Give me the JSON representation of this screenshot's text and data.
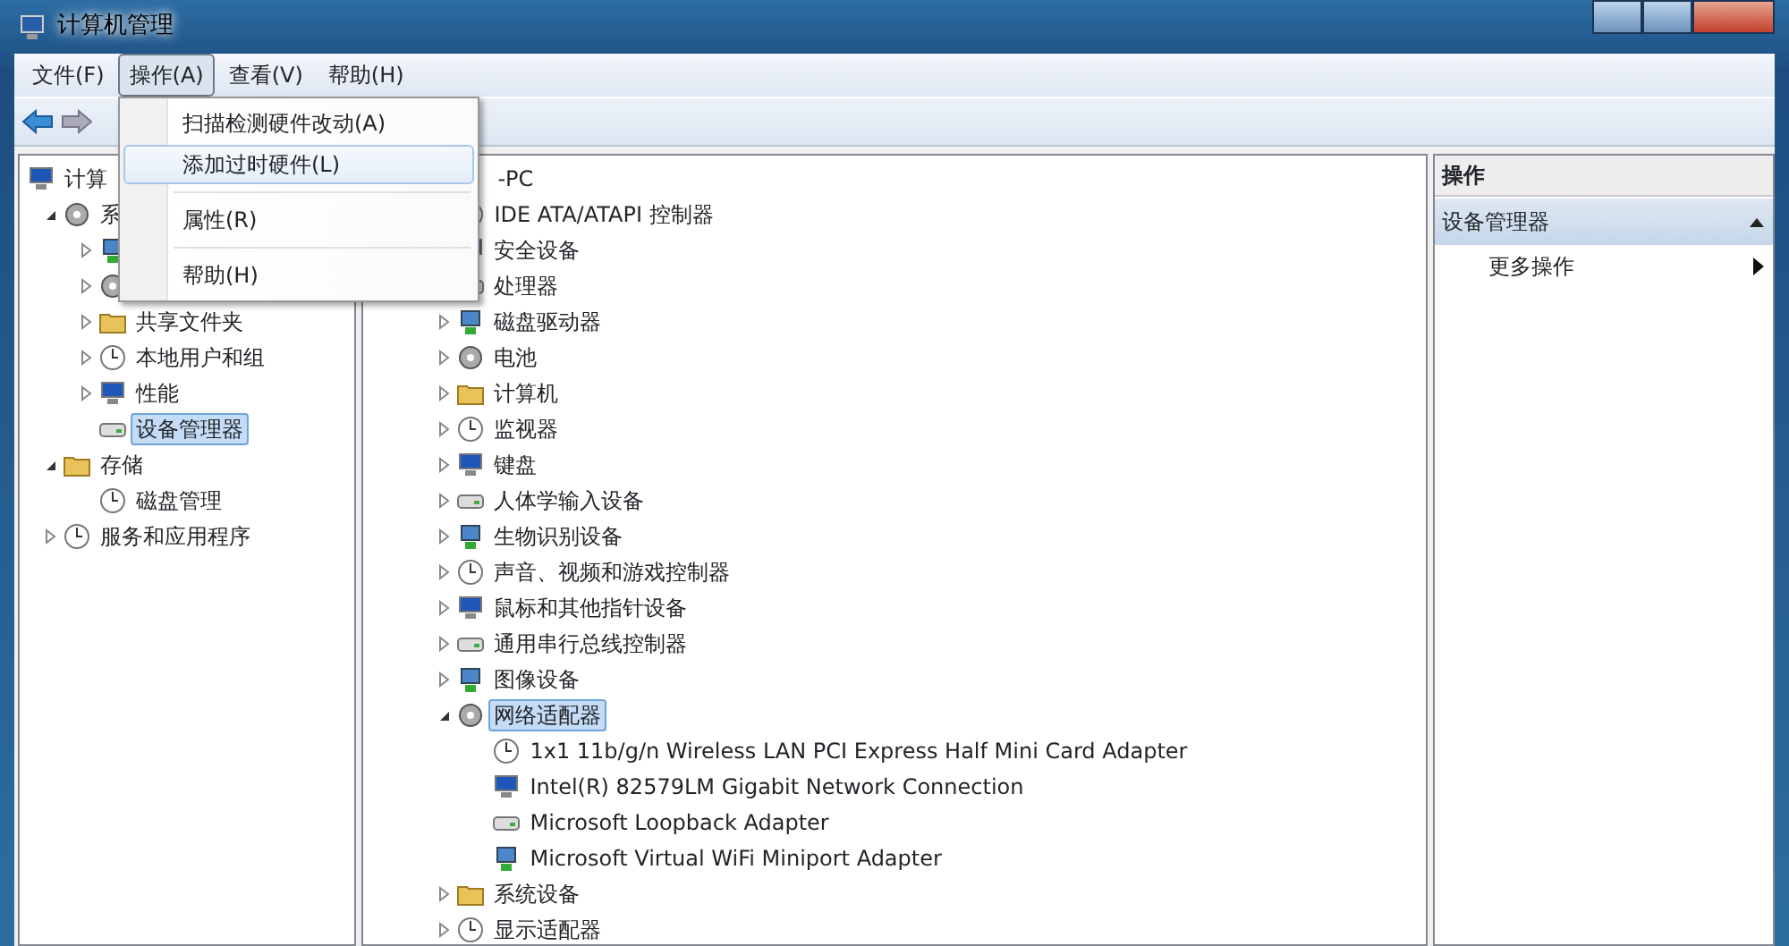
{
  "window": {
    "title": "计算机管理"
  },
  "menu_bar": [
    {
      "label": "文件(F)",
      "selected": false
    },
    {
      "label": "操作(A)",
      "selected": true
    },
    {
      "label": "查看(V)",
      "selected": false
    },
    {
      "label": "帮助(H)",
      "selected": false
    }
  ],
  "open_menu": {
    "items": [
      {
        "kind": "item",
        "label": "扫描检测硬件改动(A)",
        "selected": false
      },
      {
        "kind": "item",
        "label": "添加过时硬件(L)",
        "selected": true
      },
      {
        "kind": "separator"
      },
      {
        "kind": "item",
        "label": "属性(R)",
        "selected": false
      },
      {
        "kind": "separator"
      },
      {
        "kind": "item",
        "label": "帮助(H)",
        "selected": false
      }
    ]
  },
  "nav_tree": [
    {
      "label": "计算",
      "selected": false,
      "children": [
        {
          "label": "系",
          "expanded": true,
          "selected": false,
          "children": [
            {
              "expanded": false
            },
            {
              "expanded": false
            },
            {
              "label": "共享文件夹",
              "expanded": false,
              "selected": false
            },
            {
              "label": "本地用户和组",
              "expanded": false,
              "selected": false
            },
            {
              "label": "性能",
              "expanded": false,
              "selected": false
            },
            {
              "label": "设备管理器",
              "selected": true
            }
          ]
        },
        {
          "label": "存储",
          "expanded": true,
          "selected": false,
          "children": [
            {
              "label": "磁盘管理",
              "selected": false
            }
          ]
        },
        {
          "label": "服务和应用程序",
          "expanded": false,
          "selected": false
        }
      ]
    }
  ],
  "device_tree": [
    {
      "label": "-PC",
      "selected": false,
      "children": [
        {
          "label": "IDE ATA/ATAPI 控制器",
          "selected": false
        },
        {
          "label": "安全设备",
          "selected": false
        },
        {
          "label": "处理器",
          "selected": false
        },
        {
          "label": "磁盘驱动器",
          "expanded": false,
          "selected": false
        },
        {
          "label": "电池",
          "expanded": false,
          "selected": false
        },
        {
          "label": "计算机",
          "expanded": false,
          "selected": false
        },
        {
          "label": "监视器",
          "expanded": false,
          "selected": false
        },
        {
          "label": "键盘",
          "expanded": false,
          "selected": false
        },
        {
          "label": "人体学输入设备",
          "expanded": false,
          "selected": false
        },
        {
          "label": "生物识别设备",
          "expanded": false,
          "selected": false
        },
        {
          "label": "声音、视频和游戏控制器",
          "expanded": false,
          "selected": false
        },
        {
          "label": "鼠标和其他指针设备",
          "expanded": false,
          "selected": false
        },
        {
          "label": "通用串行总线控制器",
          "expanded": false,
          "selected": false
        },
        {
          "label": "图像设备",
          "expanded": false,
          "selected": false
        },
        {
          "label": "网络适配器",
          "expanded": true,
          "selected": true,
          "children": [
            {
              "label": "1x1 11b/g/n Wireless LAN PCI Express Half Mini Card Adapter",
              "selected": false
            },
            {
              "label": "Intel(R) 82579LM Gigabit Network Connection",
              "selected": false
            },
            {
              "label": "Microsoft Loopback Adapter",
              "selected": false
            },
            {
              "label": "Microsoft Virtual WiFi Miniport Adapter",
              "selected": false
            }
          ]
        },
        {
          "label": "系统设备",
          "expanded": false,
          "selected": false
        },
        {
          "label": "显示适配器",
          "expanded": false,
          "selected": false
        }
      ]
    }
  ],
  "actions_pane": {
    "header": "操作",
    "section": {
      "label": "设备管理器",
      "expanded": true
    },
    "items": [
      {
        "label": "更多操作"
      }
    ]
  }
}
